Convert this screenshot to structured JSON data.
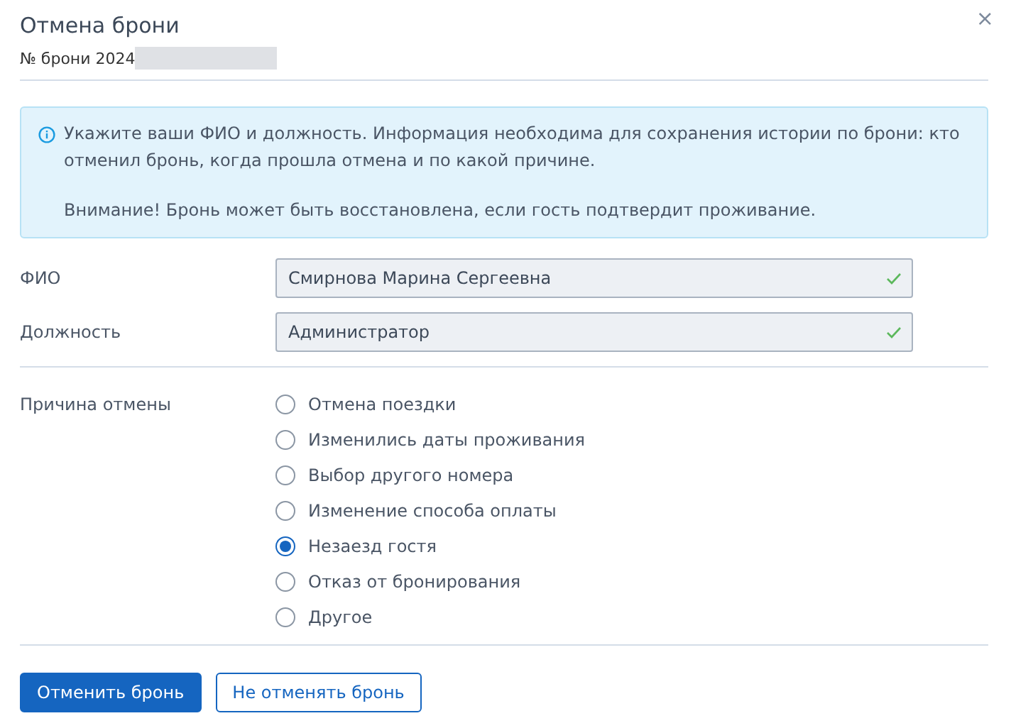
{
  "dialog": {
    "title": "Отмена брони",
    "subtitle": "№ брони 2024",
    "close": "×"
  },
  "info": {
    "lines": [
      "Укажите ваши ФИО и должность. Информация необходима для сохранения истории по брони: кто отменил бронь, когда прошла отмена и по какой причине.",
      "Внимание! Бронь может быть восстановлена, если гость подтвердит проживание."
    ]
  },
  "fields": [
    {
      "label": "ФИО",
      "value": "Смирнова Марина Сергеевна",
      "valid": true
    },
    {
      "label": "Должность",
      "value": "Администратор",
      "valid": true
    }
  ],
  "reason": {
    "label": "Причина отмены",
    "options": [
      {
        "label": "Отмена поездки",
        "selected": false
      },
      {
        "label": "Изменились даты проживания",
        "selected": false
      },
      {
        "label": "Выбор другого номера",
        "selected": false
      },
      {
        "label": "Изменение способа оплаты",
        "selected": false
      },
      {
        "label": "Незаезд гостя",
        "selected": true
      },
      {
        "label": "Отказ от бронирования",
        "selected": false
      },
      {
        "label": "Другое",
        "selected": false
      }
    ]
  },
  "buttons": [
    {
      "label": "Отменить бронь",
      "kind": "primary"
    },
    {
      "label": "Не отменять бронь",
      "kind": "secondary"
    }
  ]
}
